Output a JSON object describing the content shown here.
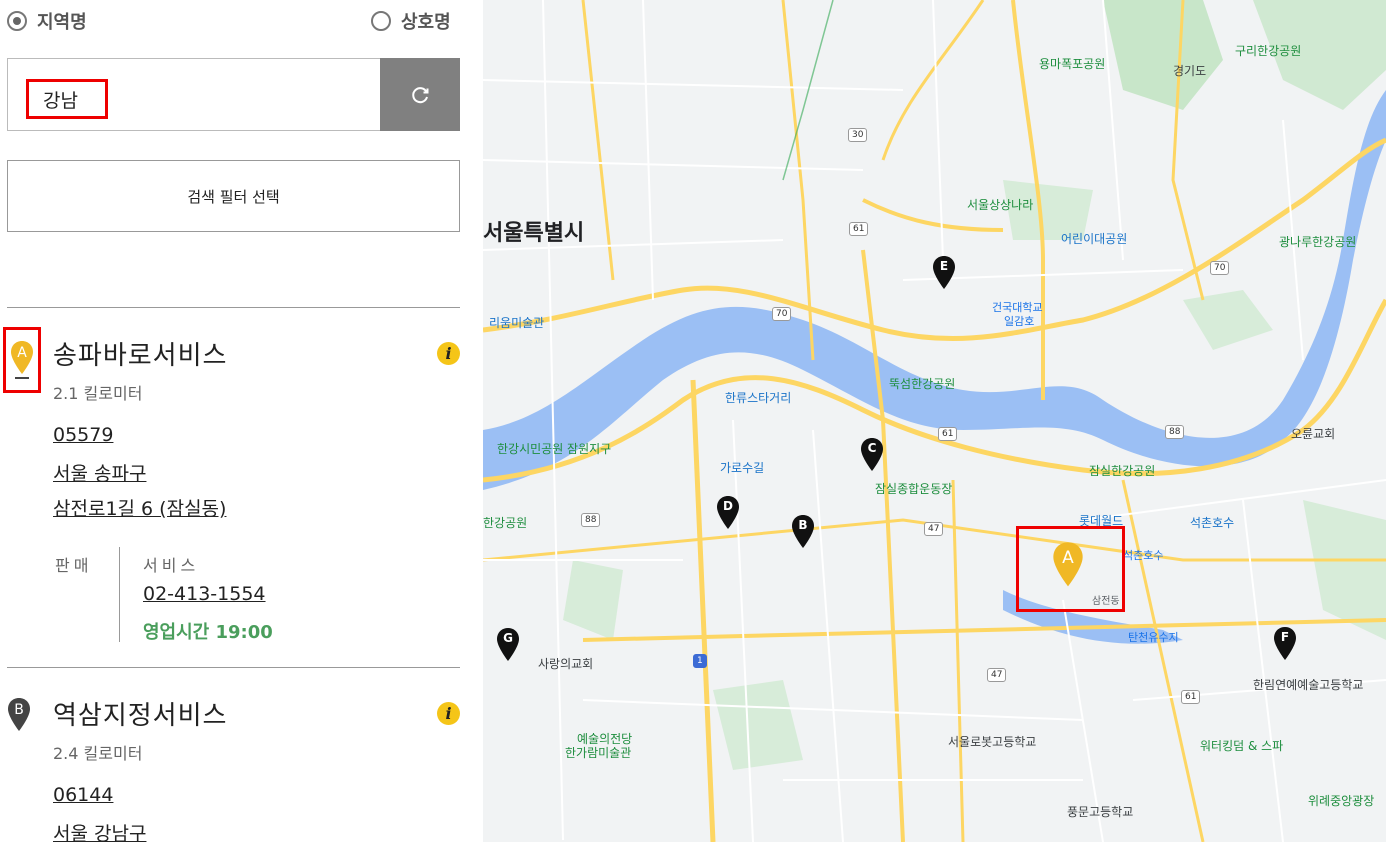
{
  "search_mode": {
    "region_label": "지역명",
    "company_label": "상호명",
    "selected": "region"
  },
  "search": {
    "value": "강남"
  },
  "filter_button": "검색 필터 선택",
  "results": [
    {
      "marker": "A",
      "name": "송파바로서비스",
      "distance": "2.1 킬로미터",
      "postal_code": "05579",
      "address_line1": "서울 송파구",
      "address_line2": "삼전로1길 6 (잠실동)",
      "sales_label": "판매",
      "service_label": "서비스",
      "phone": "02-413-1554",
      "hours": "영업시간 19:00"
    },
    {
      "marker": "B",
      "name": "역삼지정서비스",
      "distance": "2.4 킬로미터",
      "postal_code": "06144",
      "address_line1": "서울 강남구"
    }
  ],
  "map": {
    "colors": {
      "water": "#9bbff4",
      "park": "#c8e6c9",
      "road": "#fdd663",
      "land": "#f1f3f4",
      "highlight": "#ee0000",
      "marker_a": "#f0b825",
      "marker_other": "#111111"
    },
    "markers": [
      "A",
      "B",
      "C",
      "D",
      "E",
      "F",
      "G"
    ],
    "labels": {
      "seoul": "서울특별시",
      "guri_park": "구리한강공원",
      "yongma": "용마폭포공원",
      "sangsang": "서울상상나라",
      "children": "어린이대공원",
      "gwangnaru": "광나루한강공원",
      "konkuk": "건국대학교",
      "ilgamho": "일감호",
      "museum": "리움미술관",
      "ttukseom": "뚝섬한강공원",
      "hallyu": "한류스타거리",
      "jamwon": "한강시민공원 잠원지구",
      "garosu": "가로수길",
      "jamsil_park": "잠실한강공원",
      "sports": "잠실종합운동장",
      "lotte": "롯데월드",
      "seokchon": "석촌호수",
      "sarang": "사랑의교회",
      "hanlim": "한림연예예술고등학교",
      "arts": "예술의전당",
      "hangaram": "한가람미술관",
      "robot": "서울로봇고등학교",
      "waterking": "워터킹덤 & 스파",
      "wirye": "위례중앙광장",
      "pungmun": "풍문고등학교",
      "olympic": "오륜교회",
      "tancheon": "탄천유수지",
      "seoulsi": "서울특별시",
      "gyeonggi": "경기도",
      "hangang": "한강공원",
      "samjeon": "삼전동",
      "seokchon_pond": "석촌호수"
    }
  }
}
